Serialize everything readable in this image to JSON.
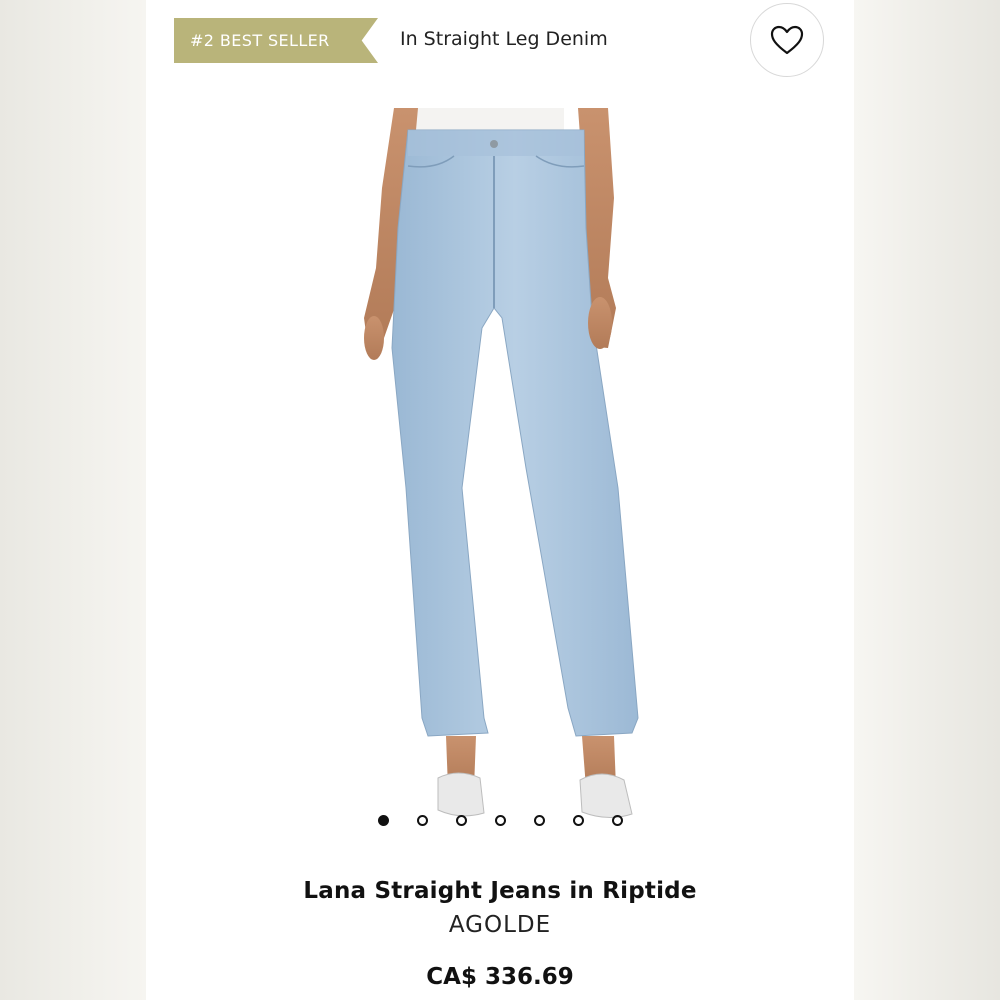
{
  "badge": {
    "label": "#2 BEST SELLER",
    "color": "#b9b47a"
  },
  "category": {
    "label": "In Straight Leg Denim"
  },
  "favorite": {
    "icon": "heart-outline-icon"
  },
  "gallery": {
    "image_count": 7,
    "active_index": 0
  },
  "product": {
    "title": "Lana Straight Jeans in Riptide",
    "brand": "AGOLDE",
    "price": "CA$ 336.69"
  }
}
